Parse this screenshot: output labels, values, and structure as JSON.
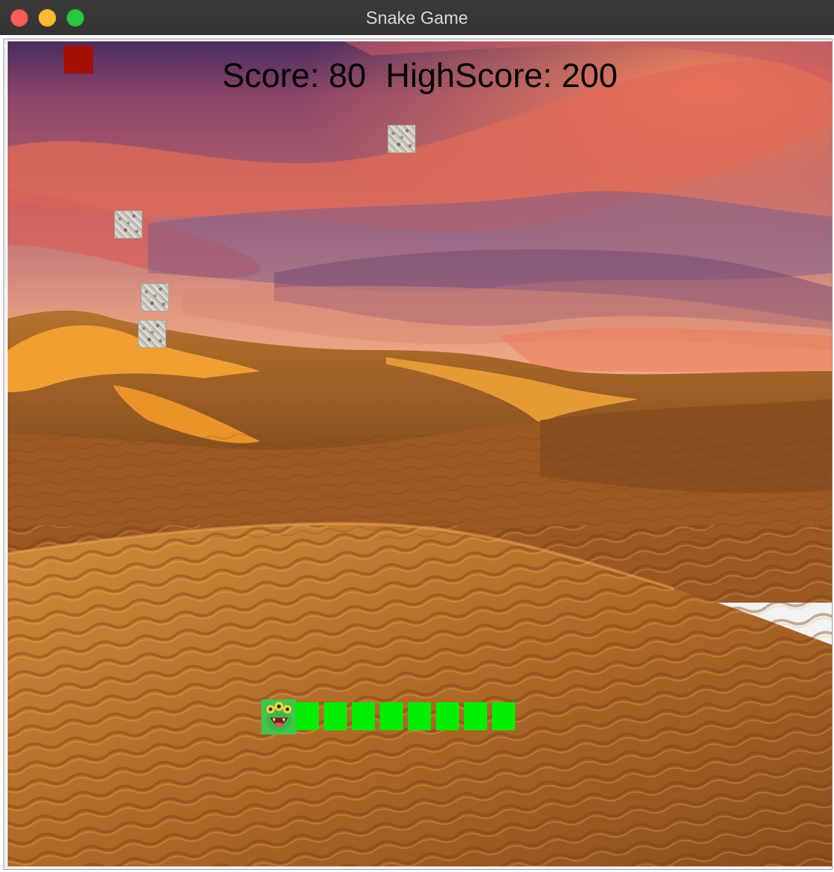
{
  "window": {
    "title": "Snake Game"
  },
  "hud": {
    "score_text": "Score: 80",
    "highscore_text": "HighScore: 200"
  },
  "game": {
    "background": "desert-sunset-dunes",
    "snake_length": 9,
    "food_color": "#a30f05",
    "snake_color": "#00ee00",
    "obstacle_count": 4
  }
}
